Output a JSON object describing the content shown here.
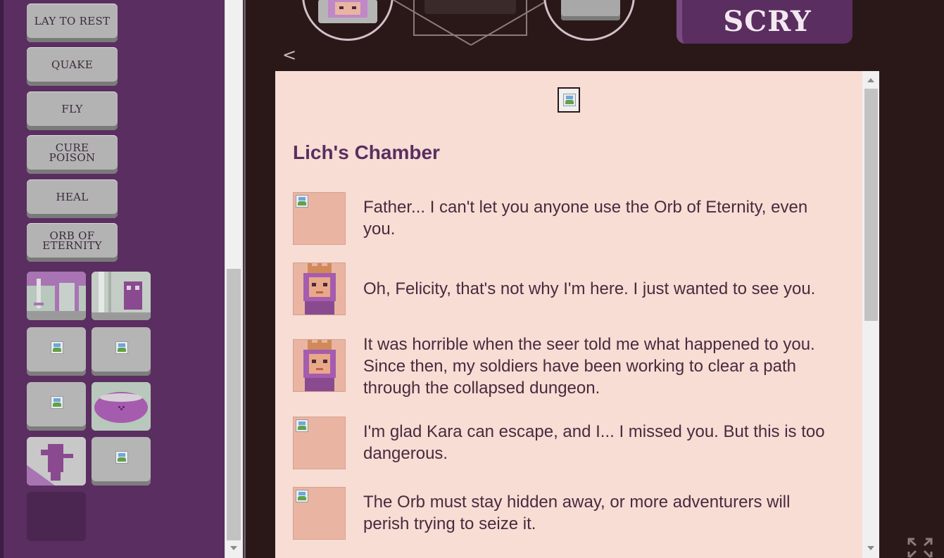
{
  "sidebar": {
    "spells": [
      {
        "label_1": "LAY TO REST",
        "label_2": ""
      },
      {
        "label_1": "QUAKE",
        "label_2": ""
      },
      {
        "label_1": "FLY",
        "label_2": ""
      },
      {
        "label_1": "CURE",
        "label_2": "POISON"
      },
      {
        "label_1": "HEAL",
        "label_2": ""
      },
      {
        "label_1": "ORB OF",
        "label_2": "ETERNITY"
      }
    ]
  },
  "header": {
    "scry_label": "SCRY",
    "back_label": "<"
  },
  "dialog": {
    "title": "Lich's Chamber",
    "messages": [
      {
        "text": "Father... I can't let you anyone use the Orb of Eternity, even you."
      },
      {
        "text": "Oh, Felicity, that's not why I'm here. I just wanted to see you."
      },
      {
        "text": "It was horrible when the seer told me what happened to you. Since then, my soldiers have been working to clear a path through the collapsed dungeon."
      },
      {
        "text": "I'm glad Kara can escape, and I... I missed you. But this is too dangerous."
      },
      {
        "text": "The Orb must stay hidden away, or more adventurers will perish trying to seize it."
      }
    ]
  },
  "colors": {
    "sidebar_bg": "#5a2e60",
    "panel_bg": "#f7ddd4",
    "title_color": "#5a2e60",
    "text_color": "#4a2a3e",
    "game_bg": "#2a1818"
  }
}
